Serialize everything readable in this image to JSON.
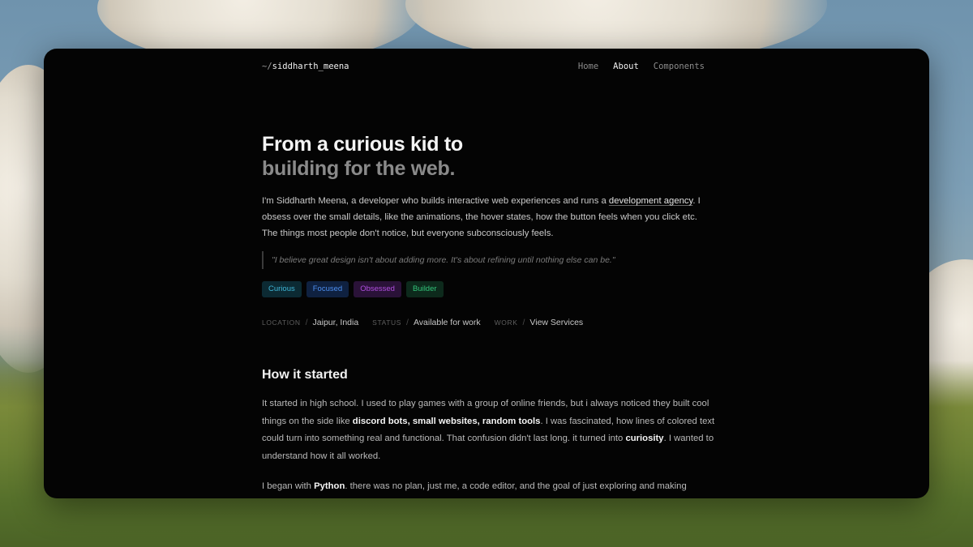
{
  "nav": {
    "brand_prefix": "~/",
    "brand_name": "siddharth_meena",
    "links": [
      {
        "label": "Home",
        "active": false
      },
      {
        "label": "About",
        "active": true
      },
      {
        "label": "Components",
        "active": false
      }
    ]
  },
  "hero": {
    "line1": "From a curious kid to",
    "line2": "building for the web."
  },
  "intro": {
    "before_link": "I'm Siddharth Meena, a developer who builds interactive web experiences and runs a ",
    "link": "development agency",
    "after_link": ". I obsess over the small details, like the animations, the hover states, how the button feels when you click etc. The things most people don't notice, but everyone subconsciously feels."
  },
  "quote": "\"I believe great design isn't about adding more. It's about refining until nothing else can be.\"",
  "tags": [
    {
      "label": "Curious",
      "color": "#3fb6d6",
      "bg": "#0c2a33"
    },
    {
      "label": "Focused",
      "color": "#4d8ff0",
      "bg": "#0f2140"
    },
    {
      "label": "Obsessed",
      "color": "#b14fe0",
      "bg": "#2a1238"
    },
    {
      "label": "Builder",
      "color": "#33c47a",
      "bg": "#0d2a1c"
    }
  ],
  "meta": {
    "separator": "/",
    "location_key": "LOCATION",
    "location_val": "Jaipur, India",
    "status_key": "STATUS",
    "status_val": "Available for work",
    "work_key": "WORK",
    "work_val": "View Services"
  },
  "section": {
    "title": "How it started",
    "p1_a": "It started in high school. I used to play games with a group of online friends, but i always noticed they built cool things on the side like ",
    "p1_b": "discord bots, small websites, random tools",
    "p1_c": ". I was fascinated, how lines of colored text could turn into something real and functional. That confusion didn't last long. it turned into ",
    "p1_d": "curiosity",
    "p1_e": ". I wanted to understand how it all worked.",
    "p2_a": "I began with ",
    "p2_b": "Python",
    "p2_c": ". there was no plan, just me, a code editor, and the goal of just exploring and making"
  }
}
